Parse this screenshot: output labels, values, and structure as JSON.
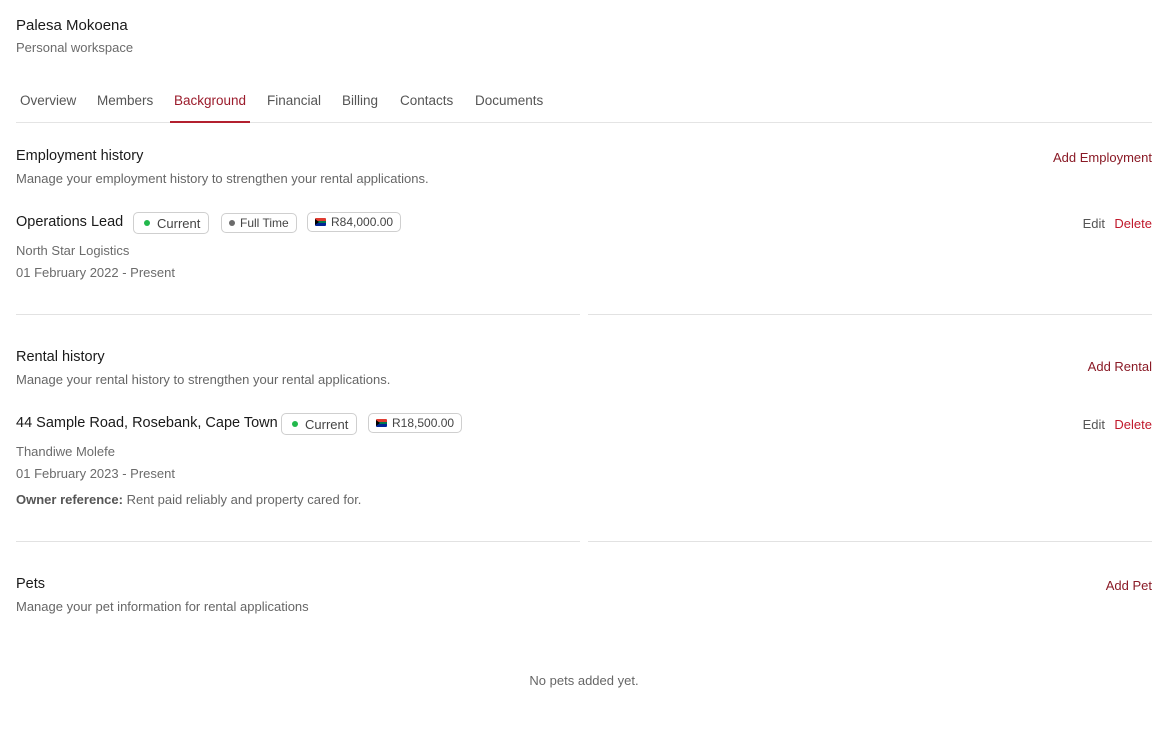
{
  "workspace": {
    "name": "Palesa Mokoena",
    "subtitle": "Personal workspace"
  },
  "tabs": [
    {
      "label": "Overview"
    },
    {
      "label": "Members"
    },
    {
      "label": "Background",
      "active": true
    },
    {
      "label": "Financial"
    },
    {
      "label": "Billing"
    },
    {
      "label": "Contacts"
    },
    {
      "label": "Documents"
    }
  ],
  "employment": {
    "title": "Employment history",
    "description": "Manage your employment history to strengthen your rental applications.",
    "add_label": "Add Employment",
    "item": {
      "title": "Operations Lead",
      "status": "Current",
      "type": "Full Time",
      "amount": "R84,000.00",
      "company": "North Star Logistics",
      "period": "01 February 2022 - Present",
      "edit_label": "Edit",
      "delete_label": "Delete"
    }
  },
  "rental": {
    "title": "Rental history",
    "description": "Manage your rental history to strengthen your rental applications.",
    "add_label": "Add Rental",
    "item": {
      "title": "44 Sample Road, Rosebank, Cape Town",
      "status": "Current",
      "amount": "R18,500.00",
      "owner": "Thandiwe Molefe",
      "period": "01 February 2023 - Present",
      "reference_label": "Owner reference:",
      "reference_text": "Rent paid reliably and property cared for.",
      "edit_label": "Edit",
      "delete_label": "Delete"
    }
  },
  "pets": {
    "title": "Pets",
    "description": "Manage your pet information for rental applications",
    "add_label": "Add Pet",
    "empty_text": "No pets added yet."
  },
  "colors": {
    "accent": "#9b1c2c",
    "delete": "#c0182b",
    "status_current": "#22b84c",
    "status_fulltime": "#6b6b6b"
  },
  "icons": {
    "currency_flag": "south-africa-flag-icon",
    "status_dot": "dot-icon"
  }
}
